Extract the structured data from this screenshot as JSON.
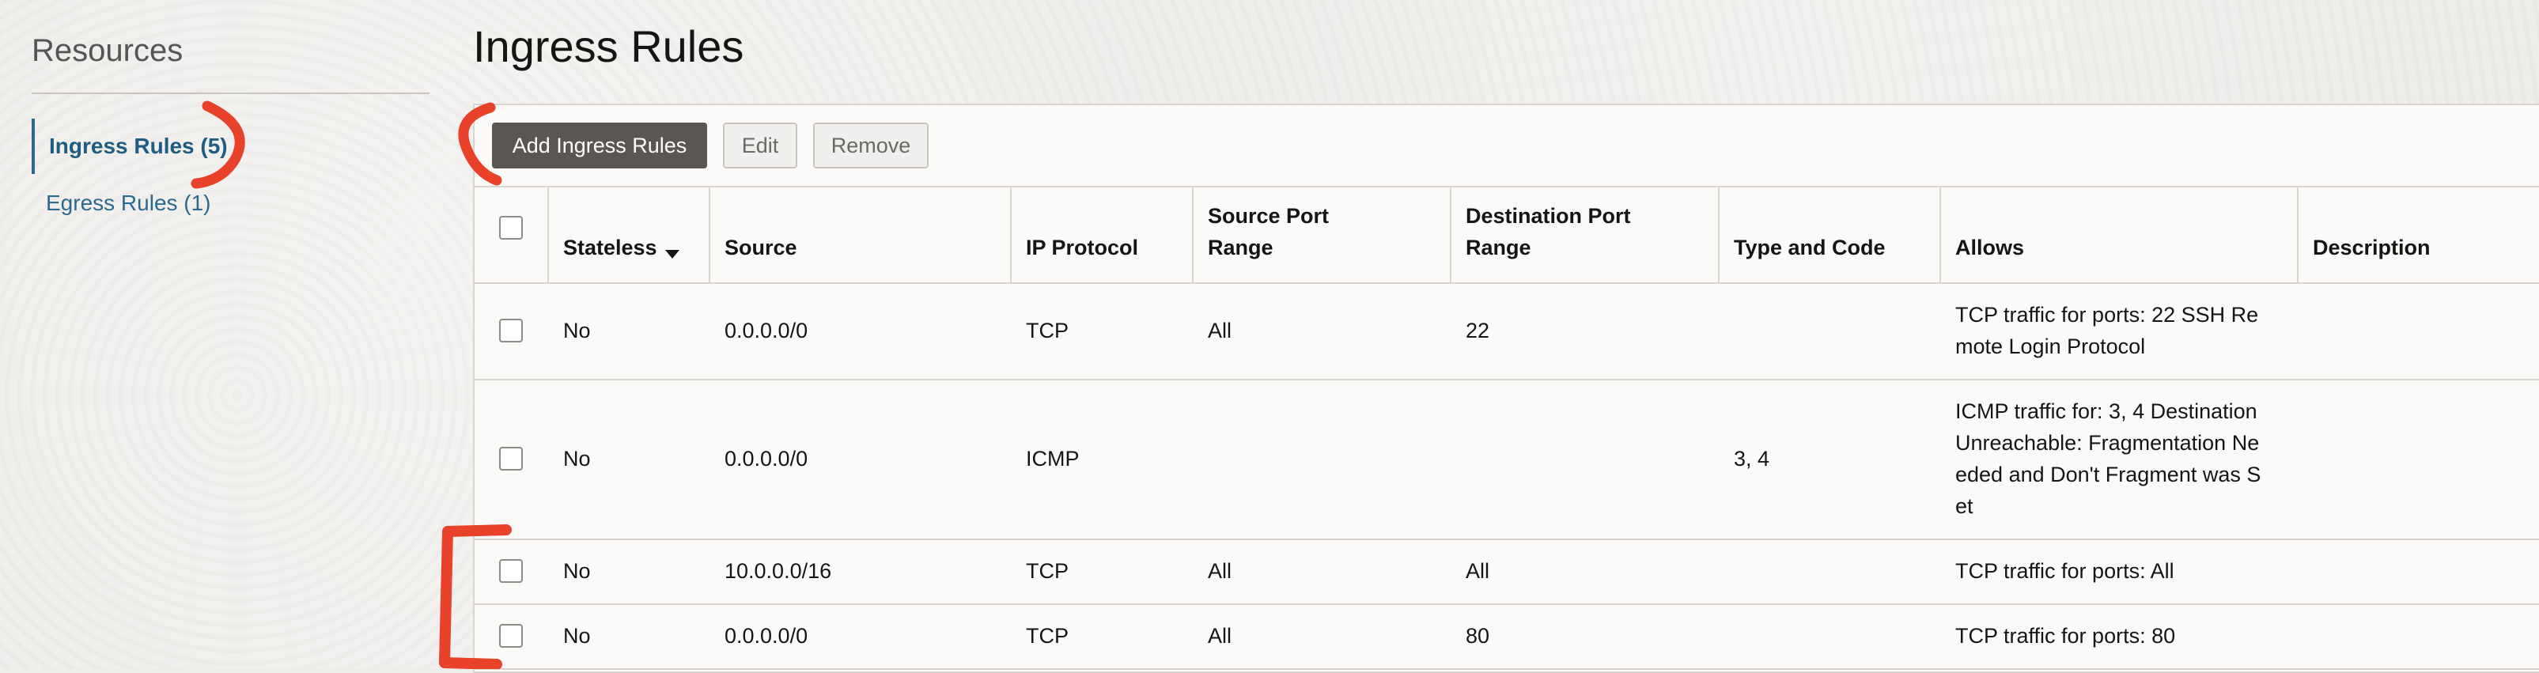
{
  "sidebar": {
    "title": "Resources",
    "items": [
      {
        "label": "Ingress Rules (5)",
        "active": true
      },
      {
        "label": "Egress Rules (1)",
        "active": false
      }
    ]
  },
  "page": {
    "title": "Ingress Rules"
  },
  "toolbar": {
    "add_label": "Add Ingress Rules",
    "edit_label": "Edit",
    "remove_label": "Remove"
  },
  "table": {
    "headers": {
      "stateless": "Stateless",
      "source": "Source",
      "ip_protocol": "IP Protocol",
      "source_port_l1": "Source Port",
      "source_port_l2": "Range",
      "dest_port_l1": "Destination Port",
      "dest_port_l2": "Range",
      "type_code": "Type and Code",
      "allows": "Allows",
      "description": "Description"
    },
    "rows": [
      {
        "stateless": "No",
        "source": "0.0.0.0/0",
        "ip_protocol": "TCP",
        "source_port": "All",
        "dest_port": "22",
        "type_code": "",
        "allows": "TCP traffic for ports: 22 SSH Re mote Login Protocol",
        "description": ""
      },
      {
        "stateless": "No",
        "source": "0.0.0.0/0",
        "ip_protocol": "ICMP",
        "source_port": "",
        "dest_port": "",
        "type_code": "3, 4",
        "allows": "ICMP traffic for: 3, 4 Destination Unreachable: Fragmentation Ne eded and Don't Fragment was S et",
        "description": ""
      },
      {
        "stateless": "No",
        "source": "10.0.0.0/16",
        "ip_protocol": "TCP",
        "source_port": "All",
        "dest_port": "All",
        "type_code": "",
        "allows": "TCP traffic for ports: All",
        "description": ""
      },
      {
        "stateless": "No",
        "source": "0.0.0.0/0",
        "ip_protocol": "TCP",
        "source_port": "All",
        "dest_port": "80",
        "type_code": "",
        "allows": "TCP traffic for ports: 80",
        "description": ""
      }
    ]
  },
  "colors": {
    "annotation": "#e8432a",
    "link": "#2a6a8f",
    "primary_button": "#5b5651"
  },
  "icons": {
    "sort": "caret-down-icon"
  }
}
